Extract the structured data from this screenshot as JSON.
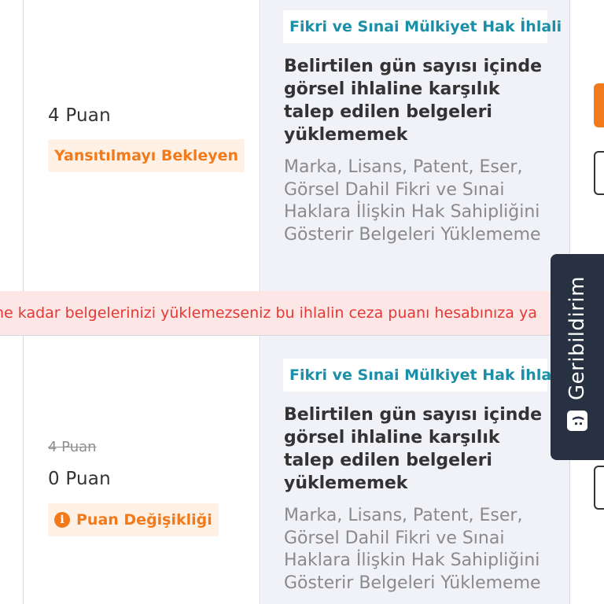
{
  "rows": [
    {
      "points": "4 Puan",
      "status_badge": "Yansıtılmayı Bekleyen",
      "category": "Fikri ve Sınai Mülkiyet Hak İhlali",
      "title": "Belirtilen gün sayısı içinde görsel ihlaline karşılık talep edilen belgeleri yüklememek",
      "description": "Marka, Lisans, Patent, Eser, Görsel Dahil Fikri ve Sınai Haklara İlişkin Hak Sahipliğini Gösterir Belgeleri Yüklememe"
    },
    {
      "points_old": "4 Puan",
      "points": "0 Puan",
      "status_badge": "Puan Değişikliği",
      "category": "Fikri ve Sınai Mülkiyet Hak İhlali",
      "title": "Belirtilen gün sayısı içinde görsel ihlaline karşılık talep edilen belgeleri yüklememek",
      "description": "Marka, Lisans, Patent, Eser, Görsel Dahil Fikri ve Sınai Haklara İlişkin Hak Sahipliğini Gösterir Belgeleri Yüklememe"
    }
  ],
  "warning_text": "ne kadar belgelerinizi yüklemezseniz bu ihlalin ceza puanı hesabınıza ya",
  "feedback_tab": {
    "label": "Geribildirim",
    "icon": "smile-icon"
  },
  "icons": {
    "info": "info-icon"
  },
  "colors": {
    "accent_orange": "#f27a1a",
    "category_teal": "#1b8fa7",
    "warning_red": "#e53935",
    "warning_bg": "#fde7e6",
    "feedback_bg": "#273142"
  }
}
